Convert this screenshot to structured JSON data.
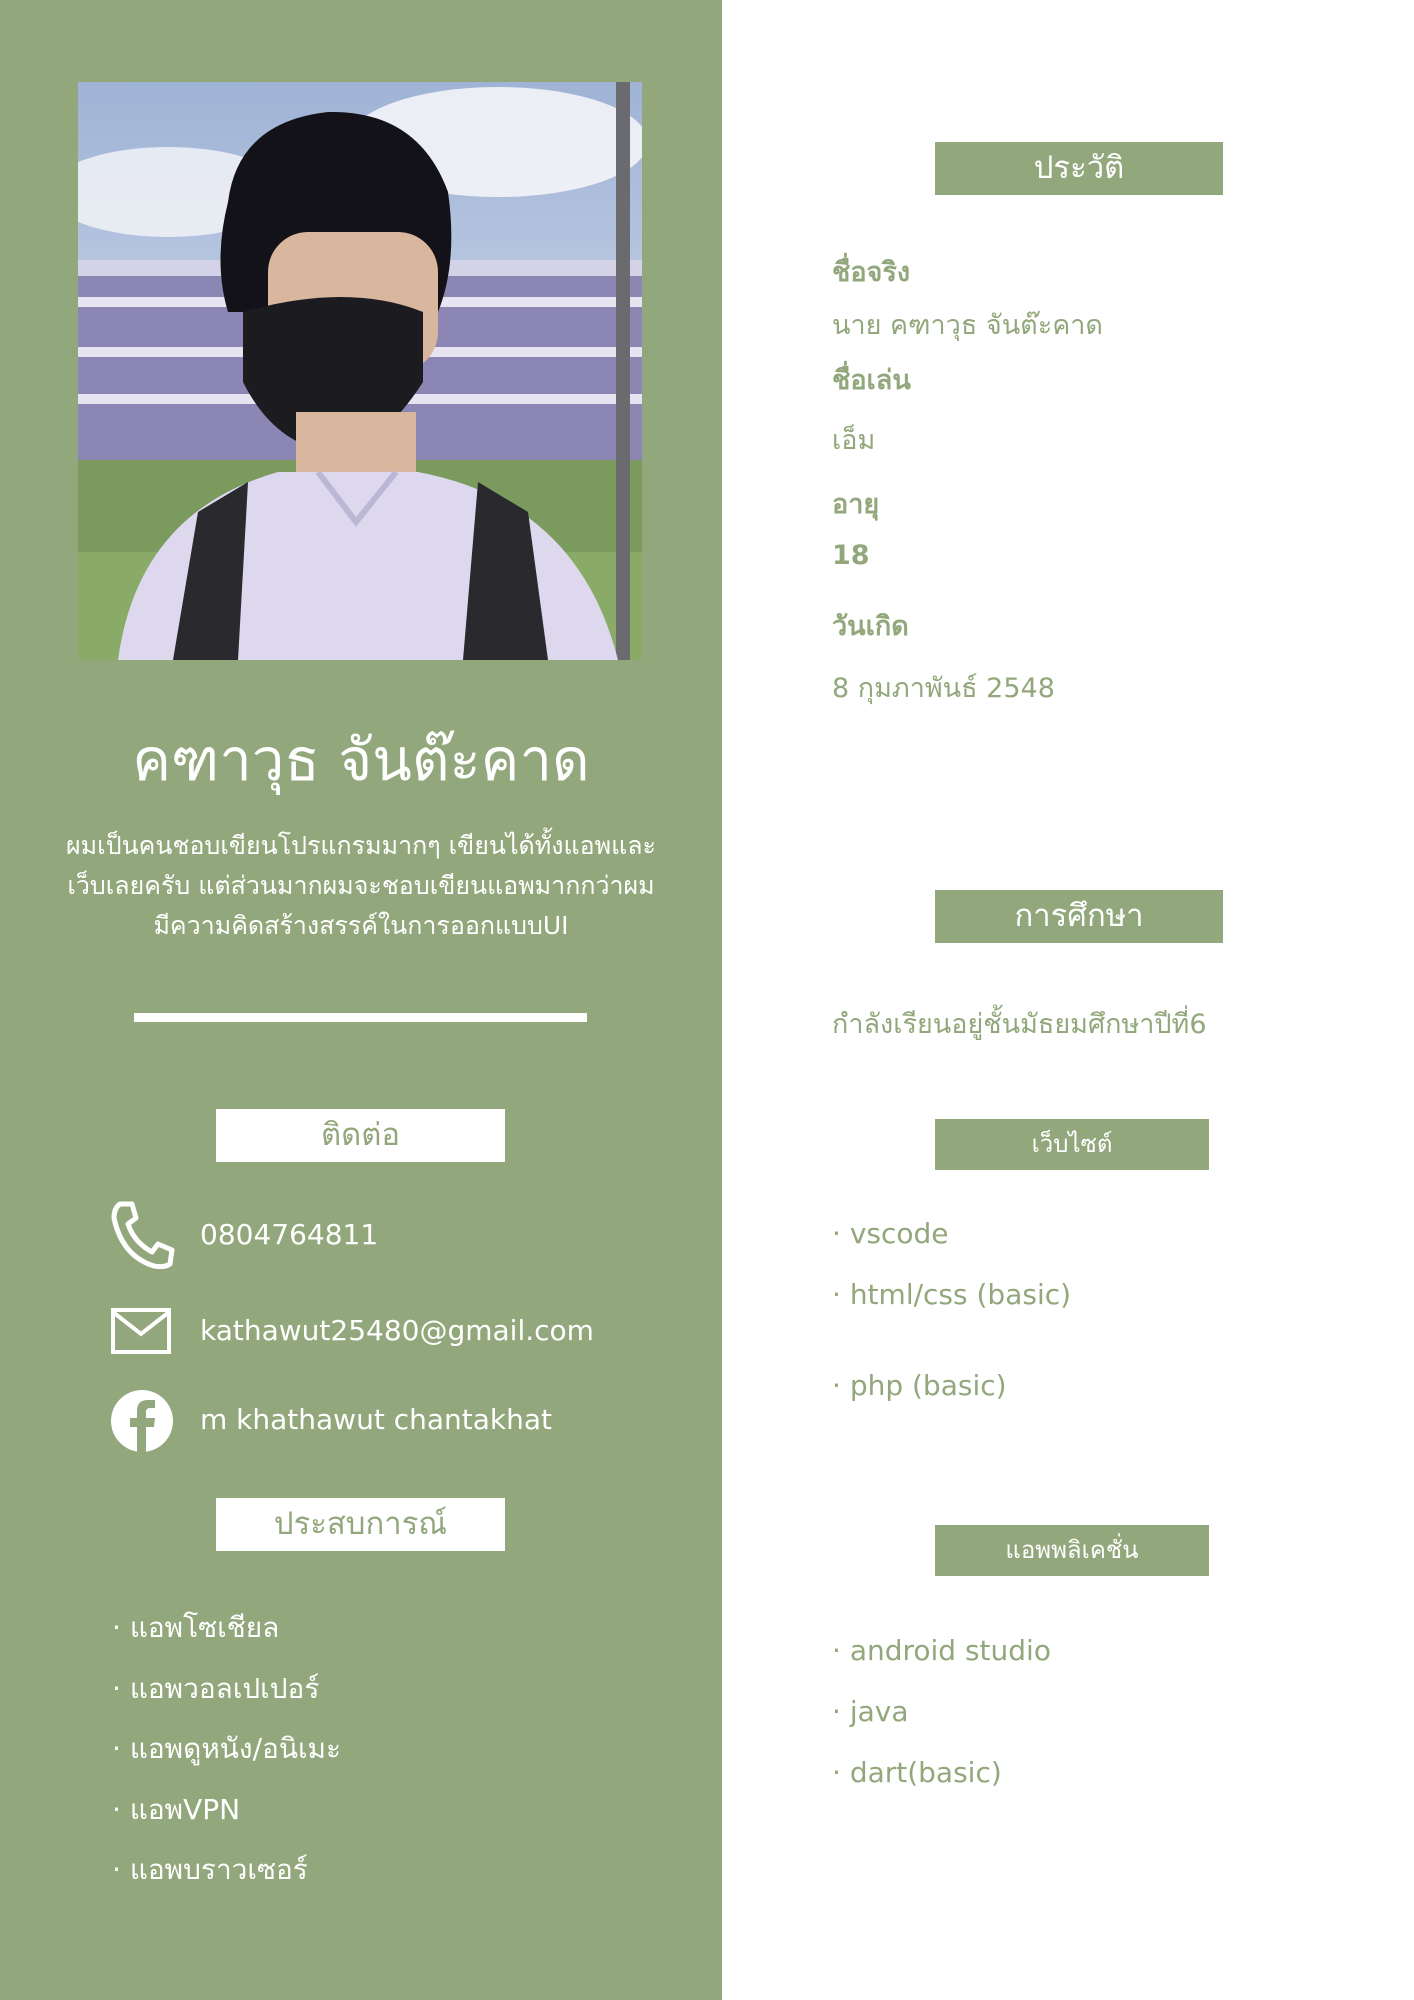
{
  "profile": {
    "photo_alt": "profile-photo",
    "name": "คฑาวุธ จันต๊ะคาด",
    "bio_lines": [
      "ผมเป็นคนชอบเขียนโปรแกรมมากๆ เขียนได้ทั้งแอพและ",
      "เว็บเลยครับ แต่ส่วนมากผมจะชอบเขียนแอพมากกว่าผม",
      "มีความคิดสร้างสรรค์ในการออกแบบUI"
    ]
  },
  "contact": {
    "heading": "ติดต่อ",
    "phone": "0804764811",
    "email": "kathawut25480@gmail.com",
    "facebook": "m khathawut chantakhat"
  },
  "experience": {
    "heading": "ประสบการณ์",
    "items": [
      "แอพโซเชียล",
      "แอพวอลเปเปอร์",
      "แอพดูหนัง/อนิเมะ",
      "แอพVPN",
      "แอพบราวเซอร์"
    ]
  },
  "history": {
    "heading": "ประวัติ",
    "real_name_label": "ชื่อจริง",
    "real_name": "นาย คฑาวุธ จันต๊ะคาด",
    "nickname_label": "ชื่อเล่น",
    "nickname": "เอ็ม",
    "age_label": "อายุ",
    "age": "18",
    "birthday_label": "วันเกิด",
    "birthday": "8 กุมภาพันธ์ 2548"
  },
  "education": {
    "heading": "การศึกษา",
    "text": "กำลังเรียนอยู่ชั้นมัธยมศึกษาปีที่6"
  },
  "website": {
    "heading": "เว็บไซต์",
    "items": [
      "vscode",
      "html/css (basic)",
      "php (basic)"
    ]
  },
  "application": {
    "heading": "แอพพลิเคชั่น",
    "items": [
      "android studio",
      "java",
      "dart(basic)"
    ]
  },
  "colors": {
    "sage": "#92a77b",
    "white": "#ffffff"
  },
  "icons": {
    "phone": "phone-icon",
    "email": "envelope-icon",
    "facebook": "facebook-icon"
  }
}
